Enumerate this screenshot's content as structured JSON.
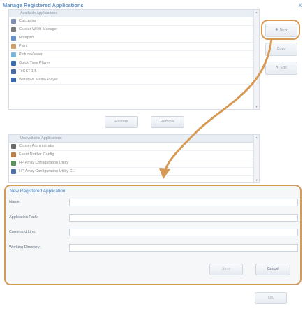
{
  "window": {
    "title": "Manage Registered Applications",
    "close": "x"
  },
  "available": {
    "header": "Available Applications",
    "items": [
      {
        "label": "Calculator",
        "icon": "calculator-icon",
        "color": "#7f8fb2"
      },
      {
        "label": "Cluster Wildfi Manager",
        "icon": "cluster-icon",
        "color": "#7a7a7a"
      },
      {
        "label": "Notepad",
        "icon": "notepad-icon",
        "color": "#6c93c8"
      },
      {
        "label": "Paint",
        "icon": "paint-icon",
        "color": "#c9a06a"
      },
      {
        "label": "PictureViewer",
        "icon": "picture-viewer-icon",
        "color": "#7cb6dc"
      },
      {
        "label": "Quick Time Player",
        "icon": "quicktime-icon",
        "color": "#3b6fb4"
      },
      {
        "label": "TeSST 1.5",
        "icon": "tesst-icon",
        "color": "#4a6aa3"
      },
      {
        "label": "Windows Media Player",
        "icon": "media-player-icon",
        "color": "#3d67b1"
      }
    ]
  },
  "actions": {
    "restore": "Restore",
    "remove": "Remove"
  },
  "unavailable": {
    "header": "Unavailable Applications",
    "items": [
      {
        "label": "Cluster Administrator",
        "icon": "cluster-admin-icon",
        "color": "#6b6b6b"
      },
      {
        "label": "Event Notifier Config",
        "icon": "event-notifier-icon",
        "color": "#b87f4a"
      },
      {
        "label": "HP Array Configuration Utility",
        "icon": "hp-array-icon",
        "color": "#5b8f5b"
      },
      {
        "label": "HP Array Configuration Utility CLI",
        "icon": "hp-array-cli-icon",
        "color": "#4f6fa8"
      }
    ]
  },
  "side": {
    "new": "New",
    "copy": "Copy",
    "edit": "Edit"
  },
  "form": {
    "title": "New Registered Application",
    "name_label": "Name:",
    "path_label": "Application Path:",
    "cmd_label": "Command Line:",
    "dir_label": "Working Directory:",
    "name_value": "",
    "path_value": "",
    "cmd_value": "",
    "dir_value": "",
    "save": "Save",
    "cancel": "Cancel"
  },
  "footer": {
    "ok": "OK"
  },
  "accent": "#d79a55"
}
